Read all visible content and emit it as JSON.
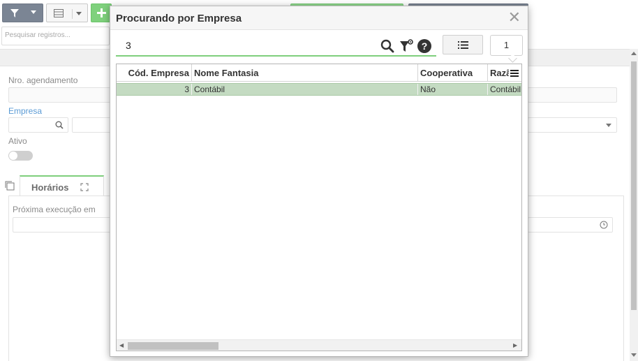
{
  "background": {
    "search_placeholder": "Pesquisar registros...",
    "labels": {
      "nro_agendamento": "Nro. agendamento",
      "empresa": "Empresa",
      "ativo": "Ativo",
      "proxima_execucao": "Próxima execução em"
    },
    "tab_label": "Horários",
    "colors": {
      "accent_green": "#7ecf7c",
      "link_blue": "#5b9bd5",
      "dark_button": "#7b8594"
    }
  },
  "modal": {
    "title": "Procurando por Empresa",
    "search_value": "3",
    "page_number": "1",
    "icons": [
      "search-icon",
      "filter-settings-icon",
      "help-icon",
      "list-icon",
      "close-icon"
    ],
    "grid": {
      "columns": [
        "Cód. Empresa",
        "Nome Fantasia",
        "Cooperativa",
        "Razã"
      ],
      "rows": [
        {
          "codigo": "3",
          "nome": "Contábil",
          "cooperativa": "Não",
          "razao": "Contábil"
        }
      ],
      "selected_row_color": "#c4dbc2"
    }
  }
}
